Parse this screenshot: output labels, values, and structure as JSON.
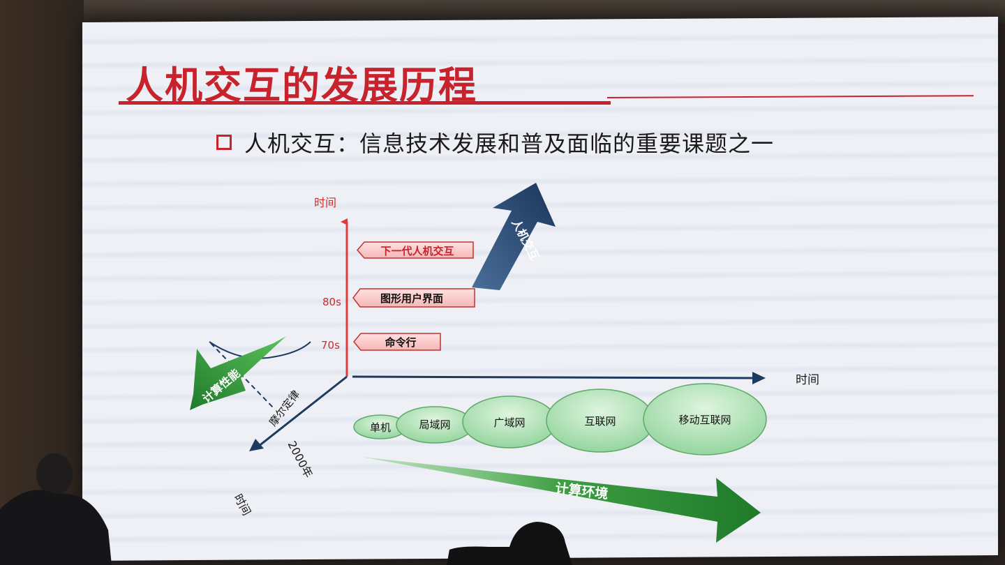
{
  "slide": {
    "title": "人机交互的发展历程",
    "bullet": "人机交互：信息技术发展和普及面临的重要课题之一"
  },
  "diagram": {
    "vertical_axis_label": "时间",
    "horizontal_axis_label": "时间",
    "diagonal_axis_label": "时间",
    "year_label": "2000年",
    "ticks": {
      "t70": "70s",
      "t80": "80s"
    },
    "interfaces": {
      "cli": "命令行",
      "gui": "图形用户界面",
      "next": "下一代人机交互"
    },
    "hci_arrow_label": "人机交互",
    "perf_arrow_label": "计算性能",
    "moore_label": "摩尔定律",
    "env_arrow_label": "计算环境",
    "environments": {
      "standalone": "单机",
      "lan": "局域网",
      "wan": "广域网",
      "internet": "互联网",
      "mobile": "移动互联网"
    }
  },
  "colors": {
    "title_red": "#c8222c",
    "axis_navy": "#1d3a5f",
    "arrow_green": "#2f8a34",
    "ellipse_green": "#b5e3b8"
  }
}
